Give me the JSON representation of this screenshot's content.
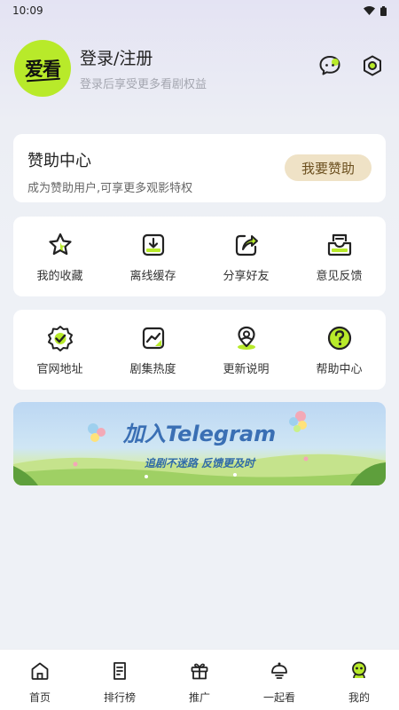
{
  "status_bar": {
    "time": "10:09"
  },
  "profile": {
    "avatar_text": "爱看",
    "title": "登录/注册",
    "subtitle": "登录后享受更多看剧权益"
  },
  "sponsor": {
    "title": "赞助中心",
    "subtitle": "成为赞助用户,可享更多观影特权",
    "button": "我要赞助"
  },
  "features1": [
    {
      "label": "我的收藏",
      "icon": "star-icon"
    },
    {
      "label": "离线缓存",
      "icon": "download-icon"
    },
    {
      "label": "分享好友",
      "icon": "share-icon"
    },
    {
      "label": "意见反馈",
      "icon": "inbox-icon"
    }
  ],
  "features2": [
    {
      "label": "官网地址",
      "icon": "verified-badge-icon"
    },
    {
      "label": "剧集热度",
      "icon": "trend-chart-icon"
    },
    {
      "label": "更新说明",
      "icon": "location-pin-icon"
    },
    {
      "label": "帮助中心",
      "icon": "question-icon"
    }
  ],
  "banner": {
    "title": "加入Telegram",
    "subtitle": "追剧不迷路 反馈更及时"
  },
  "tabbar": [
    {
      "label": "首页",
      "icon": "home-icon"
    },
    {
      "label": "排行榜",
      "icon": "ranking-icon"
    },
    {
      "label": "推广",
      "icon": "gift-icon"
    },
    {
      "label": "一起看",
      "icon": "watch-together-icon"
    },
    {
      "label": "我的",
      "icon": "profile-face-icon"
    }
  ],
  "colors": {
    "accent_green": "#b8ea2a",
    "sponsor_button_bg": "#efe2c6",
    "banner_blue": "#3a6fb4"
  }
}
